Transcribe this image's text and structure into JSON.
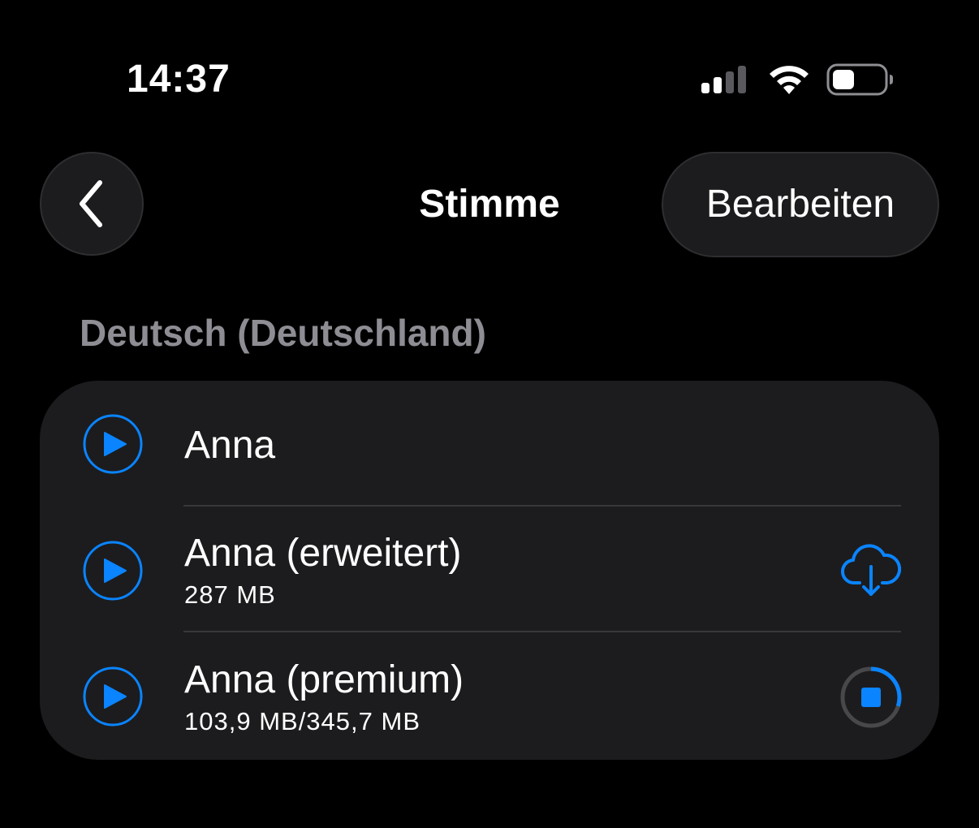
{
  "status_bar": {
    "time": "14:37",
    "icons": [
      "cellular-signal-icon",
      "wifi-icon",
      "battery-icon"
    ]
  },
  "nav": {
    "back_icon": "chevron-left-icon",
    "title": "Stimme",
    "edit_label": "Bearbeiten"
  },
  "section": {
    "header": "Deutsch (Deutschland)",
    "voices": [
      {
        "name": "Anna",
        "size": "",
        "action": "none"
      },
      {
        "name": "Anna (erweitert)",
        "size": "287 MB",
        "action": "cloud-download-icon"
      },
      {
        "name": "Anna (premium)",
        "size": "103,9 MB/345,7 MB",
        "action": "download-progress-stop-icon",
        "progress": 0.3
      }
    ]
  },
  "colors": {
    "accent": "#0a84ff",
    "background": "#000000",
    "card": "#1c1c1e",
    "secondary_text": "#8d8d93",
    "separator": "#38383b",
    "progress_track": "#48484a"
  }
}
